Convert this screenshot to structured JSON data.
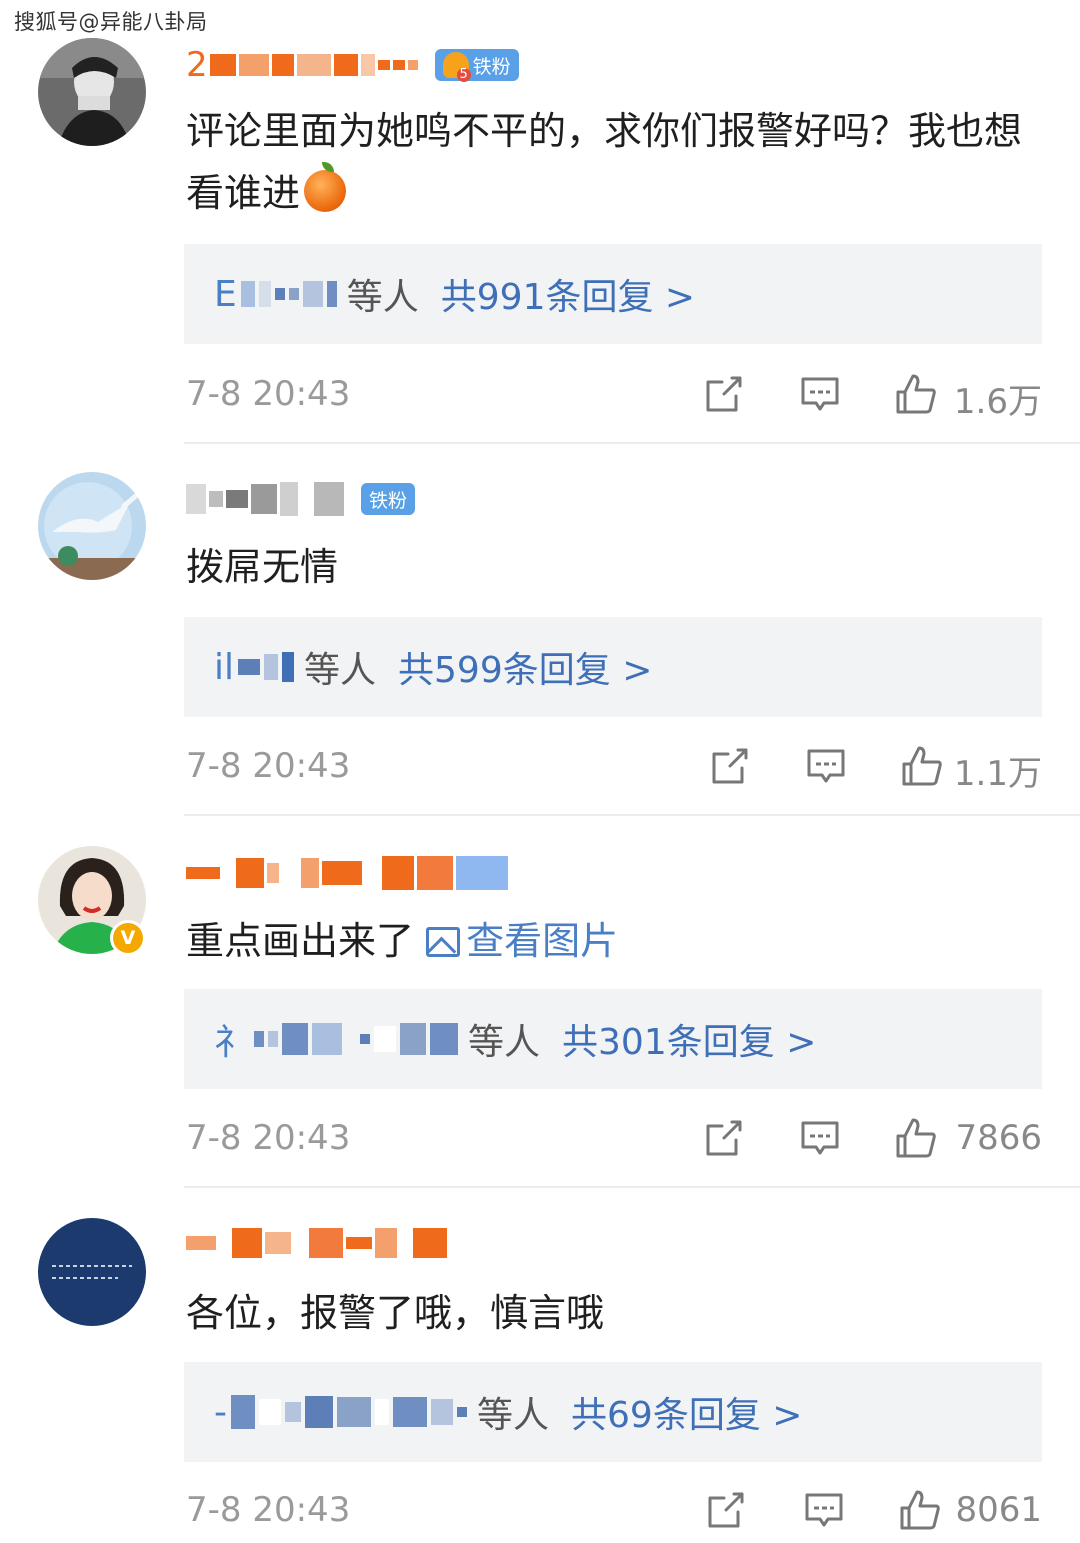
{
  "watermark": "搜狐号@异能八卦局",
  "comments": [
    {
      "name_prefix": "2",
      "fan_badge": "铁粉",
      "text": "评论里面为她鸣不平的，求你们报警好吗？我也想看谁进",
      "reply_prefix": "E",
      "reply_others": "等人",
      "reply_count": "共991条回复 >",
      "time": "7-8 20:43",
      "likes": "1.6万"
    },
    {
      "fan_badge": "铁粉",
      "text": "拨屌无情",
      "reply_prefix": "il",
      "reply_others": "等人",
      "reply_count": "共599条回复 >",
      "time": "7-8 20:43",
      "likes": "1.1万"
    },
    {
      "text": "重点画出来了",
      "link_text": "查看图片",
      "verified": "V",
      "reply_prefix": "礻",
      "reply_others": "等人",
      "reply_count": "共301条回复 >",
      "time": "7-8 20:43",
      "likes": "7866"
    },
    {
      "text": "各位，报警了哦，慎言哦",
      "reply_prefix": "-",
      "reply_others": "等人",
      "reply_count": "共69条回复 >",
      "time": "7-8 20:43",
      "likes": "8061"
    }
  ]
}
